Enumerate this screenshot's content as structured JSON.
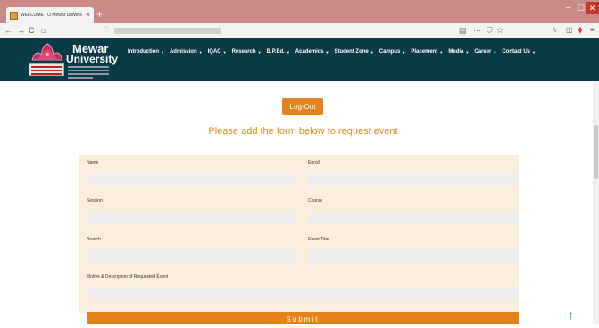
{
  "browser": {
    "tab_title": "WELCOME TO Mewar Univers",
    "tab_close": "×",
    "new_tab": "+",
    "window_controls": {
      "minimize": "–",
      "maximize": "☐",
      "close": "✕"
    },
    "nav": {
      "back": "←",
      "forward": "→",
      "reload": "C",
      "home": "⌂"
    },
    "url_icons": {
      "reader": "▤",
      "more": "···",
      "pocket": "⛉",
      "bookmark": "☆"
    },
    "tool_icons": {
      "library": "⑊",
      "sidebar": "◫",
      "pocket": "⧫",
      "menu": "≡"
    }
  },
  "site": {
    "brand_line1": "Mewar",
    "brand_line2": "University",
    "menu": [
      {
        "label": "Introduction"
      },
      {
        "label": "Admission"
      },
      {
        "label": "IQAC"
      },
      {
        "label": "Research"
      },
      {
        "label": "B.P.Ed."
      },
      {
        "label": "Academics"
      },
      {
        "label": "Student Zone"
      },
      {
        "label": "Campus"
      },
      {
        "label": "Placement"
      },
      {
        "label": "Media"
      },
      {
        "label": "Career"
      },
      {
        "label": "Contact Us"
      }
    ],
    "caret": "▼"
  },
  "page": {
    "logout_label": "Log-Out",
    "heading": "Please add the form below to request event",
    "form": {
      "name_label": "Name",
      "enroll_label": "Enroll",
      "session_label": "Session",
      "course_label": "Course",
      "branch_label": "Branch",
      "event_title_label": "Event Title",
      "motive_label": "Motive & Description of Requested Event",
      "submit_label": "Submit"
    },
    "scroll_top_icon": "↑"
  },
  "colors": {
    "header_bg": "#0b3a47",
    "accent": "#e4821c",
    "form_bg": "#fbeedd",
    "tabstrip_bg": "#c98a86"
  }
}
